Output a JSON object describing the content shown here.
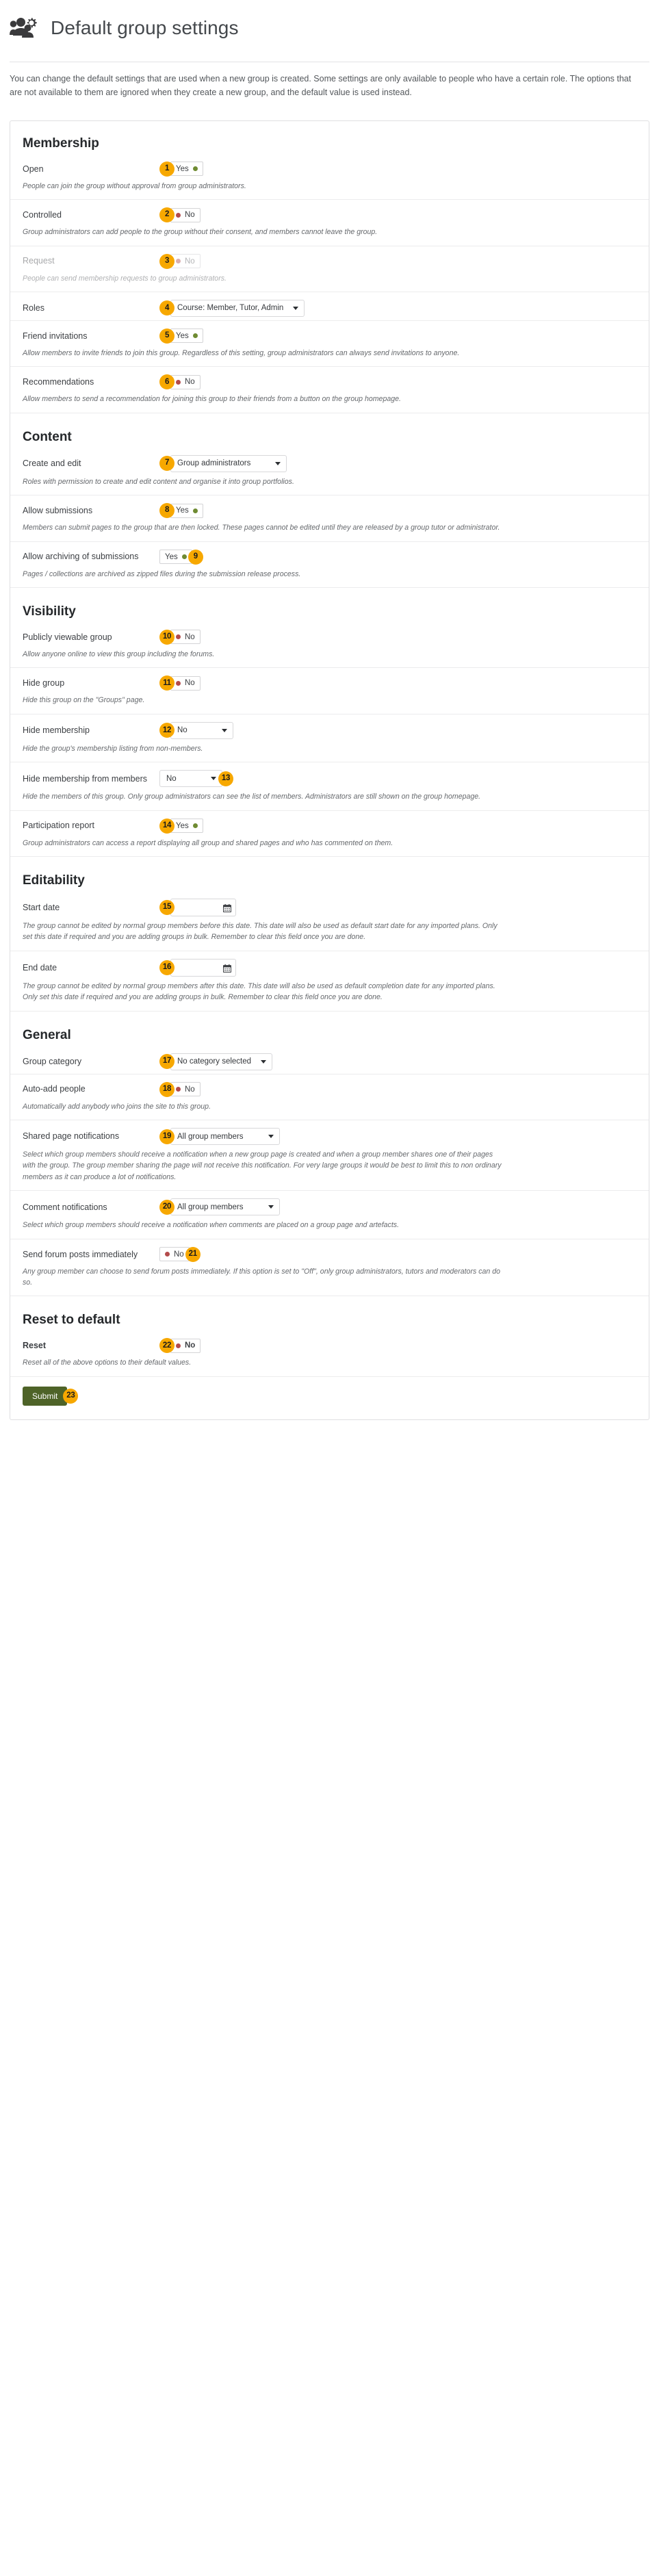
{
  "header": {
    "title": "Default group settings",
    "icon": "group-settings-icon"
  },
  "intro": "You can change the default settings that are used when a new group is created. Some settings are only available to people who have a certain role. The options that are not available to them are ignored when they create a new group, and the default value is used instead.",
  "colors": {
    "badge_bg": "#f7a800",
    "switch_on_dot": "#6f8b32",
    "switch_off_dot": "#b34b4b",
    "submit_bg": "#4e6328"
  },
  "sections": [
    {
      "title": "Membership",
      "rows": [
        {
          "badge": "1",
          "badge_position": "before",
          "label": "Open",
          "control": "switch",
          "value": "Yes",
          "state": "on",
          "desc": "People can join the group without approval from group administrators."
        },
        {
          "badge": "2",
          "badge_position": "before",
          "label": "Controlled",
          "control": "switch",
          "value": "No",
          "state": "off",
          "desc": "Group administrators can add people to the group without their consent, and members cannot leave the group."
        },
        {
          "badge": "3",
          "badge_position": "before",
          "label": "Request",
          "control": "switch",
          "value": "No",
          "state": "off",
          "disabled": true,
          "desc": "People can send membership requests to group administrators."
        },
        {
          "badge": "4",
          "badge_position": "before",
          "label": "Roles",
          "control": "select",
          "value": "Course: Member, Tutor, Admin",
          "width": "w-roles",
          "desc": ""
        },
        {
          "badge": "5",
          "badge_position": "before",
          "label": "Friend invitations",
          "control": "switch",
          "value": "Yes",
          "state": "on",
          "desc": "Allow members to invite friends to join this group. Regardless of this setting, group administrators can always send invitations to anyone."
        },
        {
          "badge": "6",
          "badge_position": "before",
          "label": "Recommendations",
          "control": "switch",
          "value": "No",
          "state": "off",
          "desc": "Allow members to send a recommendation for joining this group to their friends from a button on the group homepage."
        }
      ]
    },
    {
      "title": "Content",
      "rows": [
        {
          "badge": "7",
          "badge_position": "before",
          "label": "Create and edit",
          "control": "select",
          "value": "Group administrators",
          "width": "w-create",
          "desc": "Roles with permission to create and edit content and organise it into group portfolios."
        },
        {
          "badge": "8",
          "badge_position": "before",
          "label": "Allow submissions",
          "control": "switch",
          "value": "Yes",
          "state": "on",
          "desc": "Members can submit pages to the group that are then locked. These pages cannot be edited until they are released by a group tutor or administrator."
        },
        {
          "badge": "9",
          "badge_position": "after",
          "label": "Allow archiving of submissions",
          "control": "switch",
          "value": "Yes",
          "state": "on",
          "desc": "Pages / collections are archived as zipped files during the submission release process."
        }
      ]
    },
    {
      "title": "Visibility",
      "rows": [
        {
          "badge": "10",
          "badge_position": "before",
          "label": "Publicly viewable group",
          "control": "switch",
          "value": "No",
          "state": "off",
          "desc": "Allow anyone online to view this group including the forums."
        },
        {
          "badge": "11",
          "badge_position": "before",
          "label": "Hide group",
          "control": "switch",
          "value": "No",
          "state": "off",
          "desc": "Hide this group on the \"Groups\" page."
        },
        {
          "badge": "12",
          "badge_position": "before",
          "label": "Hide membership",
          "control": "select",
          "value": "No",
          "width": "w-small",
          "desc": "Hide the group's membership listing from non-members."
        },
        {
          "badge": "13",
          "badge_position": "after",
          "label": "Hide membership from members",
          "control": "select",
          "value": "No",
          "width": "w-small",
          "desc": "Hide the members of this group. Only group administrators can see the list of members. Administrators are still shown on the group homepage."
        },
        {
          "badge": "14",
          "badge_position": "before",
          "label": "Participation report",
          "control": "switch",
          "value": "Yes",
          "state": "on",
          "desc": "Group administrators can access a report displaying all group and shared pages and who has commented on them."
        }
      ]
    },
    {
      "title": "Editability",
      "rows": [
        {
          "badge": "15",
          "badge_position": "before",
          "label": "Start date",
          "control": "date",
          "value": "",
          "desc": "The group cannot be edited by normal group members before this date. This date will also be used as default start date for any imported plans. Only set this date if required and you are adding groups in bulk. Remember to clear this field once you are done."
        },
        {
          "badge": "16",
          "badge_position": "before",
          "label": "End date",
          "control": "date",
          "value": "",
          "desc": "The group cannot be edited by normal group members after this date. This date will also be used as default completion date for any imported plans. Only set this date if required and you are adding groups in bulk. Remember to clear this field once you are done."
        }
      ]
    },
    {
      "title": "General",
      "rows": [
        {
          "badge": "17",
          "badge_position": "before",
          "label": "Group category",
          "control": "select",
          "value": "No category selected",
          "width": "w-cat",
          "desc": ""
        },
        {
          "badge": "18",
          "badge_position": "before",
          "label": "Auto-add people",
          "control": "switch",
          "value": "No",
          "state": "off",
          "desc": "Automatically add anybody who joins the site to this group."
        },
        {
          "badge": "19",
          "badge_position": "before",
          "label": "Shared page notifications",
          "control": "select",
          "value": "All group members",
          "width": "w-notify",
          "desc": "Select which group members should receive a notification when a new group page is created and when a group member shares one of their pages with the group. The group member sharing the page will not receive this notification. For very large groups it would be best to limit this to non ordinary members as it can produce a lot of notifications."
        },
        {
          "badge": "20",
          "badge_position": "before",
          "label": "Comment notifications",
          "control": "select",
          "value": "All group members",
          "width": "w-notify",
          "desc": "Select which group members should receive a notification when comments are placed on a group page and artefacts."
        },
        {
          "badge": "21",
          "badge_position": "after",
          "label": "Send forum posts immediately",
          "control": "switch",
          "value": "No",
          "state": "off",
          "desc": "Any group member can choose to send forum posts immediately. If this option is set to \"Off\", only group administrators, tutors and moderators can do so."
        }
      ]
    },
    {
      "title": "Reset to default",
      "rows": [
        {
          "badge": "22",
          "badge_position": "before",
          "label": "Reset",
          "label_strong": true,
          "control": "switch",
          "value": "No",
          "state": "off",
          "switch_strong": true,
          "desc": "Reset all of the above options to their default values."
        }
      ]
    }
  ],
  "submit": {
    "label": "Submit",
    "badge": "23"
  }
}
